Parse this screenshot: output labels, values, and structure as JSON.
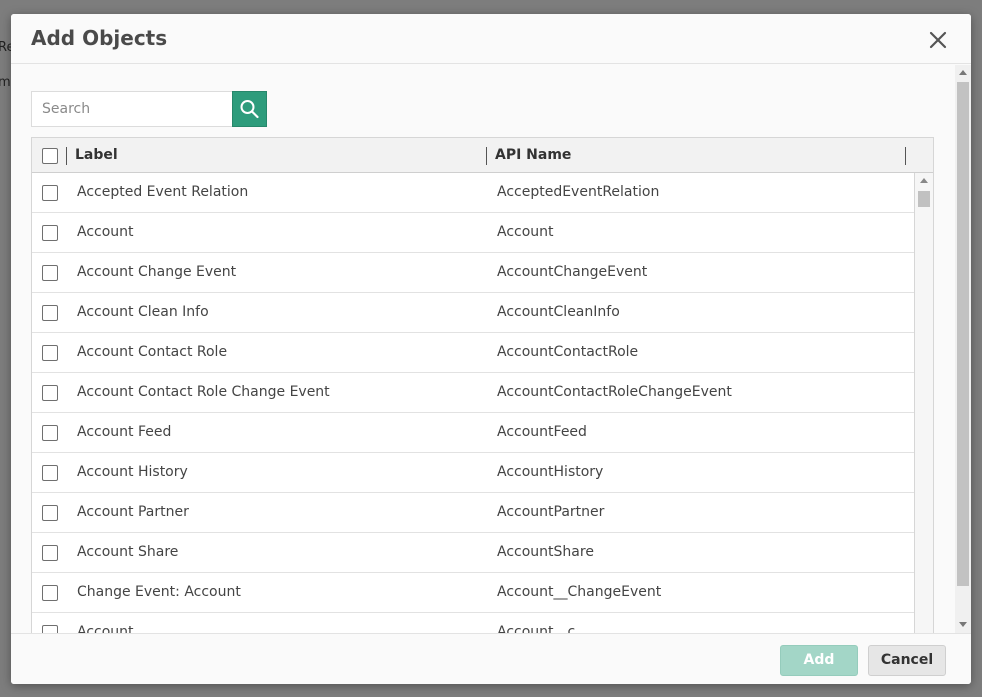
{
  "background": {
    "frag1": "Re",
    "frag2": "m"
  },
  "modal": {
    "title": "Add Objects",
    "search": {
      "placeholder": "Search",
      "value": ""
    },
    "columns": {
      "label": "Label",
      "api": "API Name"
    },
    "rows": [
      {
        "label": "Accepted Event Relation",
        "api": "AcceptedEventRelation"
      },
      {
        "label": "Account",
        "api": "Account"
      },
      {
        "label": "Account Change Event",
        "api": "AccountChangeEvent"
      },
      {
        "label": "Account Clean Info",
        "api": "AccountCleanInfo"
      },
      {
        "label": "Account Contact Role",
        "api": "AccountContactRole"
      },
      {
        "label": "Account Contact Role Change Event",
        "api": "AccountContactRoleChangeEvent"
      },
      {
        "label": "Account Feed",
        "api": "AccountFeed"
      },
      {
        "label": "Account History",
        "api": "AccountHistory"
      },
      {
        "label": "Account Partner",
        "api": "AccountPartner"
      },
      {
        "label": "Account Share",
        "api": "AccountShare"
      },
      {
        "label": "Change Event: Account",
        "api": "Account__ChangeEvent"
      },
      {
        "label": "Account",
        "api": "Account__c"
      }
    ],
    "footer": {
      "add_label": "Add",
      "cancel_label": "Cancel"
    }
  },
  "colors": {
    "accent": "#2e9c7c",
    "accent_disabled": "#a3d6c7"
  },
  "icons": {
    "close": "close-icon",
    "search": "search-icon",
    "checkbox": "checkbox-icon"
  }
}
